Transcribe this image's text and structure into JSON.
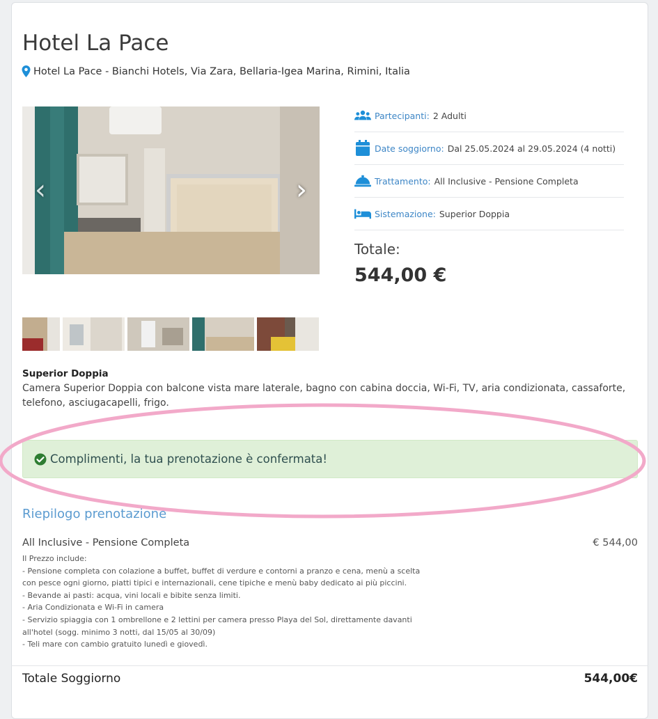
{
  "hotel": {
    "name": "Hotel La Pace",
    "address": "Hotel La Pace - Bianchi Hotels, Via Zara, Bellaria-Igea Marina, Rimini, Italia"
  },
  "gallery": {
    "prev_icon": "‹",
    "next_icon": "›",
    "thumbnails": 5
  },
  "details": {
    "participants": {
      "label": "Partecipanti:",
      "value": "2 Adulti",
      "icon": "users-icon"
    },
    "dates": {
      "label": "Date soggiorno:",
      "value": "Dal 25.05.2024 al 29.05.2024 (4 notti)",
      "icon": "calendar-icon"
    },
    "treatment": {
      "label": "Trattamento:",
      "value": "All Inclusive - Pensione Completa",
      "icon": "service-bell-icon"
    },
    "room": {
      "label": "Sistemazione:",
      "value": "Superior Doppia",
      "icon": "bed-icon"
    }
  },
  "total": {
    "label": "Totale:",
    "value": "544,00 €"
  },
  "room": {
    "name": "Superior Doppia",
    "description": "Camera Superior Doppia con balcone vista mare laterale, bagno con cabina doccia, Wi-Fi, TV, aria condizionata, cassaforte, telefono, asciugacapelli, frigo."
  },
  "alert": {
    "message": "Complimenti, la tua prenotazione è confermata!",
    "icon": "check-circle-icon"
  },
  "summary": {
    "title": "Riepilogo prenotazione",
    "item_name": "All Inclusive - Pensione Completa",
    "item_price": "€ 544,00",
    "includes": [
      "Il Prezzo include:",
      "- Pensione completa con colazione a buffet, buffet di verdure e contorni a pranzo e cena, menù a scelta con pesce ogni giorno, piatti tipici e internazionali, cene tipiche e menù baby dedicato ai più piccini.",
      "- Bevande ai pasti: acqua, vini locali e bibite senza limiti.",
      "- Aria Condizionata e Wi-Fi in camera",
      "- Servizio spiaggia con 1 ombrellone e 2 lettini per camera presso Playa del Sol, direttamente davanti all'hotel (sogg. minimo 3 notti, dal 15/05 al 30/09)",
      "- Teli mare con cambio gratuito lunedì e giovedì."
    ],
    "grand_total_label": "Totale Soggiorno",
    "grand_total_value": "544,00€"
  },
  "colors": {
    "accent": "#3d86c6",
    "icon_blue": "#1e8fd8",
    "success_bg": "#dff0d8",
    "success_icon": "#2e7d32",
    "highlight": "#f2a9c9"
  }
}
